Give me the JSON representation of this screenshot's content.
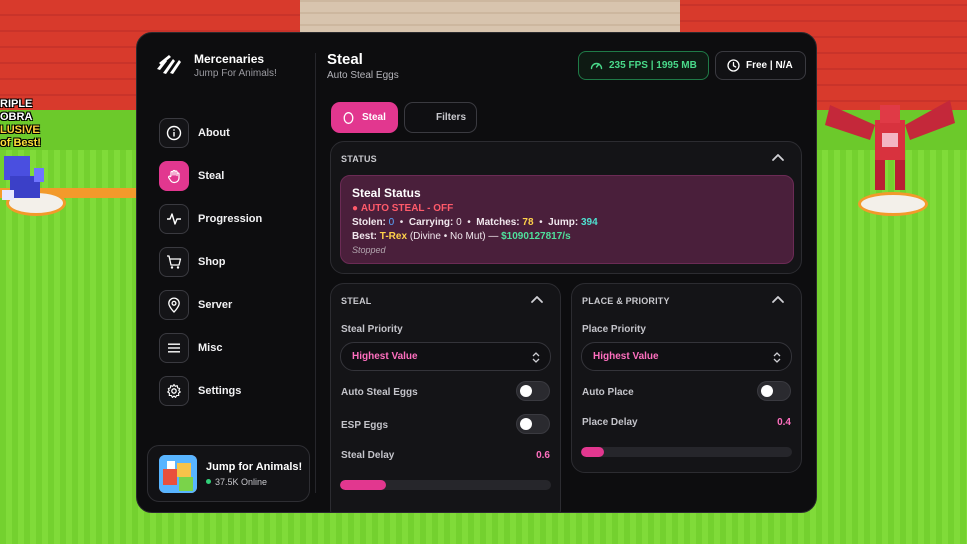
{
  "background": {
    "sign_left": [
      "RIPLE",
      "OBRA",
      "LUSIVE",
      "of Best!"
    ]
  },
  "app": {
    "name": "Mercenaries",
    "subtitle": "Jump For Animals!"
  },
  "sidebar": {
    "items": [
      {
        "label": "About",
        "icon": "info-icon",
        "active": false
      },
      {
        "label": "Steal",
        "icon": "hand-icon",
        "active": true
      },
      {
        "label": "Progression",
        "icon": "pulse-icon",
        "active": false
      },
      {
        "label": "Shop",
        "icon": "cart-icon",
        "active": false
      },
      {
        "label": "Server",
        "icon": "location-pin-icon",
        "active": false
      },
      {
        "label": "Misc",
        "icon": "menu-icon",
        "active": false
      },
      {
        "label": "Settings",
        "icon": "gear-icon",
        "active": false
      }
    ],
    "game_card": {
      "title": "Jump for Animals!",
      "online": "37.5K Online"
    }
  },
  "header": {
    "title": "Steal",
    "subtitle": "Auto Steal Eggs",
    "fps_badge": "235 FPS | 1995 MB",
    "plan_badge": "Free | N/A"
  },
  "tabs": [
    {
      "label": "Steal",
      "active": true
    },
    {
      "label": "Filters",
      "active": false
    }
  ],
  "status_panel": {
    "heading": "STATUS",
    "card": {
      "title": "Steal Status",
      "auto_steal": "AUTO STEAL - OFF",
      "stolen_label": "Stolen:",
      "stolen": "0",
      "carrying_label": "Carrying:",
      "carrying": "0",
      "matches_label": "Matches:",
      "matches": "78",
      "jump_label": "Jump:",
      "jump": "394",
      "best_label": "Best:",
      "best_name": "T-Rex",
      "best_detail": "(Divine • No Mut) —",
      "best_rate": "$1090127817/s",
      "state": "Stopped"
    }
  },
  "steal_panel": {
    "heading": "STEAL",
    "priority_label": "Steal Priority",
    "priority_value": "Highest Value",
    "auto_steal_label": "Auto Steal Eggs",
    "auto_steal_on": false,
    "esp_label": "ESP Eggs",
    "esp_on": false,
    "delay_label": "Steal Delay",
    "delay_value": "0.6",
    "delay_fraction": 0.22
  },
  "place_panel": {
    "heading": "PLACE & PRIORITY",
    "priority_label": "Place Priority",
    "priority_value": "Highest Value",
    "auto_place_label": "Auto Place",
    "auto_place_on": false,
    "delay_label": "Place Delay",
    "delay_value": "0.4",
    "delay_fraction": 0.11
  },
  "colors": {
    "accent": "#e2378f",
    "accent_text": "#ff6fbf",
    "fps_green": "#49d98a",
    "status_off": "#ff5a6a"
  }
}
